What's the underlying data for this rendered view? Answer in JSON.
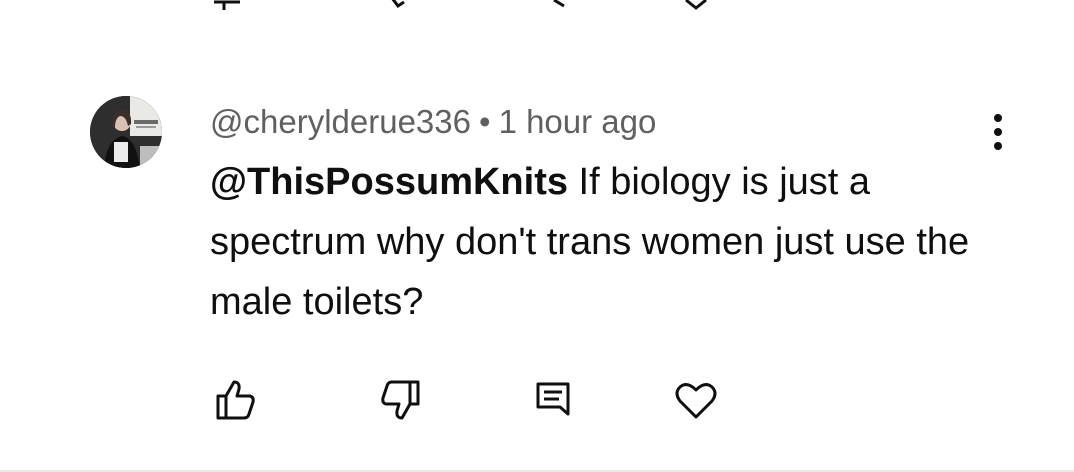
{
  "comment": {
    "username": "@cherylderue336",
    "separator": "•",
    "timestamp": "1 hour ago",
    "mention": "@ThisPossumKnits",
    "body": " If biology is just a spectrum why don't trans women just use the male toilets?",
    "avatar_icon": "user-avatar-photo"
  },
  "actions": {
    "like_icon": "thumbs-up-icon",
    "dislike_icon": "thumbs-down-icon",
    "reply_icon": "reply-comment-icon",
    "heart_icon": "heart-icon",
    "menu_icon": "more-vert-icon"
  },
  "colors": {
    "text_primary": "#0f0f0f",
    "text_secondary": "#606060",
    "icon": "#0f0f0f",
    "background": "#ffffff"
  }
}
